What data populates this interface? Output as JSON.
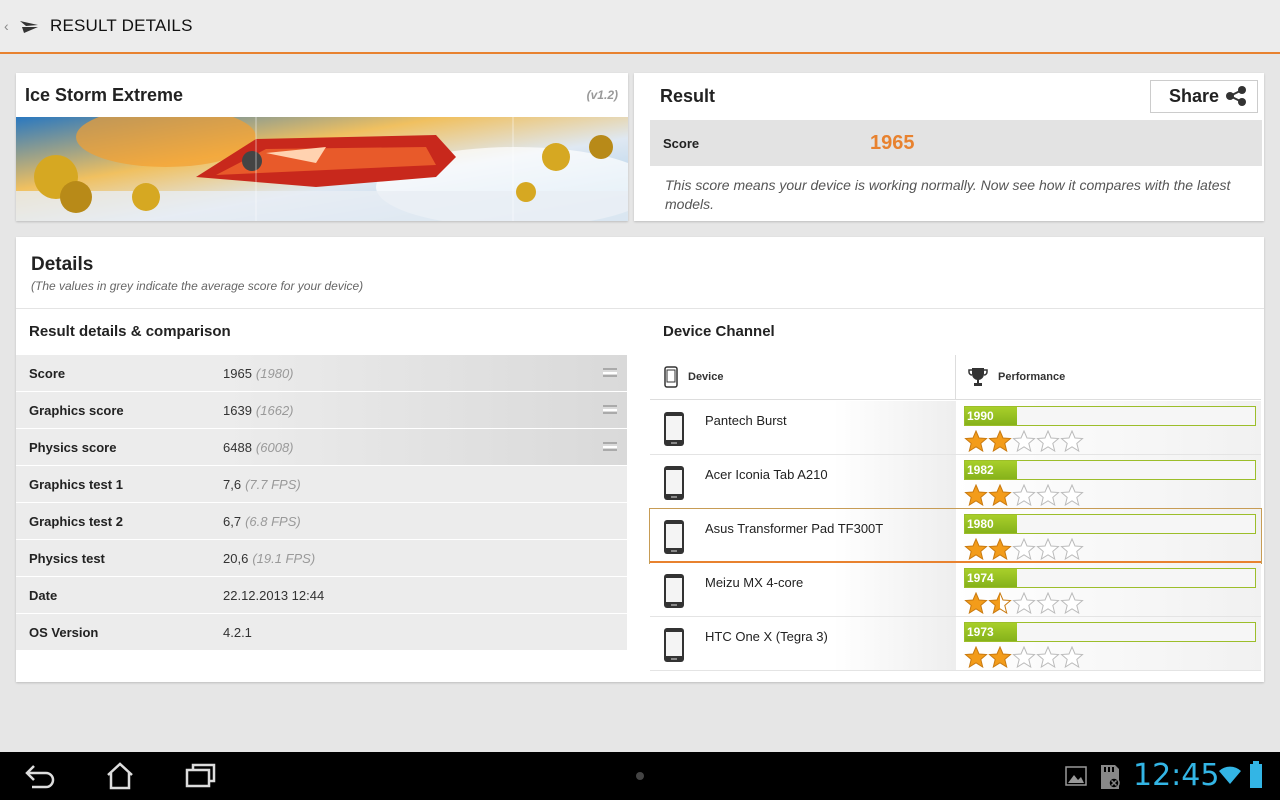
{
  "actionbar": {
    "title": "RESULT DETAILS"
  },
  "benchmark": {
    "name": "Ice Storm Extreme",
    "version": "(v1.2)"
  },
  "result": {
    "title": "Result",
    "share_label": "Share",
    "score_label": "Score",
    "score_value": "1965",
    "description": "This score means your device is working normally. Now see how it compares with the latest models."
  },
  "details": {
    "title": "Details",
    "subtitle": "(The values in grey indicate the average score for your device)",
    "comparison_title": "Result details & comparison",
    "rows": [
      {
        "label": "Score",
        "value": "1965",
        "avg": "(1980)"
      },
      {
        "label": "Graphics score",
        "value": "1639",
        "avg": "(1662)"
      },
      {
        "label": "Physics score",
        "value": "6488",
        "avg": "(6008)"
      },
      {
        "label": "Graphics test 1",
        "value": "7,6",
        "avg": "(7.7 FPS)"
      },
      {
        "label": "Graphics test 2",
        "value": "6,7",
        "avg": "(6.8 FPS)"
      },
      {
        "label": "Physics test",
        "value": "20,6",
        "avg": "(19.1 FPS)"
      },
      {
        "label": "Date",
        "value": "22.12.2013 12:44",
        "avg": ""
      },
      {
        "label": "OS Version",
        "value": "4.2.1",
        "avg": ""
      }
    ]
  },
  "channel": {
    "title": "Device Channel",
    "col_device": "Device",
    "col_performance": "Performance",
    "devices": [
      {
        "name": "Pantech Burst",
        "score": "1990",
        "fill": 0.18,
        "stars": 2
      },
      {
        "name": "Acer Iconia Tab A210",
        "score": "1982",
        "fill": 0.18,
        "stars": 2
      },
      {
        "name": "Asus Transformer Pad TF300T",
        "score": "1980",
        "fill": 0.18,
        "stars": 2
      },
      {
        "name": "Meizu MX 4-core",
        "score": "1974",
        "fill": 0.18,
        "stars": 1.5
      },
      {
        "name": "HTC One X (Tegra 3)",
        "score": "1973",
        "fill": 0.18,
        "stars": 2
      }
    ]
  },
  "status": {
    "time": "12:45"
  },
  "colors": {
    "accent": "#e8822f",
    "bar_green": "#9cbe2a",
    "clock_blue": "#33b5e5"
  }
}
